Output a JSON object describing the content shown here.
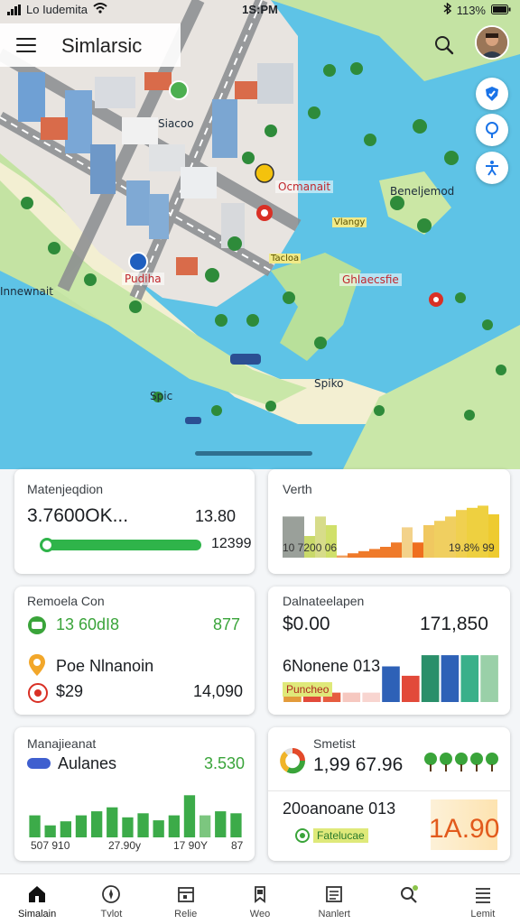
{
  "status_bar": {
    "carrier": "Lo Iudemita",
    "time": "1S:PM",
    "battery": "113%"
  },
  "app": {
    "title": "Simlarsic"
  },
  "map": {
    "labels": [
      "Siacoo",
      "Ocmanait",
      "Beneljemod",
      "Vlangy",
      "Tacloa",
      "Pudiha",
      "Ghlaecsfie",
      "Innewnait",
      "Spiko",
      "Spic"
    ]
  },
  "cards": {
    "card1": {
      "title": "Matenjeqdion",
      "value": "3.7600OK...",
      "right": "13.80",
      "progress_value": "12399",
      "progress_fraction": 0.97
    },
    "card2": {
      "title": "Verth",
      "chart_data": {
        "type": "bar",
        "values": [
          38,
          38,
          20,
          38,
          30,
          2,
          4,
          6,
          8,
          10,
          14,
          28,
          14,
          30,
          34,
          38,
          44,
          46,
          48,
          40
        ],
        "colors": [
          "#9aa09a",
          "#9aa09a",
          "#c9d96a",
          "#d7dc8a",
          "#d0e06a",
          "#f0a060",
          "#ef7a2a",
          "#ef7a2a",
          "#ef7a2a",
          "#ef7a2a",
          "#ef7a2a",
          "#f3d28a",
          "#ef6f1f",
          "#f0c860",
          "#f0cf60",
          "#f0cf60",
          "#f0d050",
          "#eed040",
          "#eed040",
          "#eecb30"
        ],
        "ylim": [
          0,
          50
        ]
      },
      "tick_left": "10 7200 06",
      "tick_right": "19.8% 99"
    },
    "card3": {
      "title": "Remoela Con",
      "row1_value": "13 60dI8",
      "row1_right": "877",
      "row2_label": "Poe Nlnanoin",
      "row3_value": "$29",
      "row3_right": "14,090"
    },
    "card4": {
      "title": "Dalnateelapen",
      "value_left": "$0.00",
      "value_right": "171,850",
      "sub_label": "6Nonene 013",
      "chart_label": "Puncheo",
      "chart_data": {
        "type": "bar",
        "values": [
          10,
          10,
          10,
          10,
          10,
          38,
          28,
          50,
          50,
          50,
          50
        ],
        "colors": [
          "#e39b3b",
          "#e24a3a",
          "#e65c3f",
          "#f6c8c0",
          "#f8d5d0",
          "#2e61b7",
          "#e24a3a",
          "#2a8f6a",
          "#2e61b7",
          "#3ab08a",
          "#9ad0a8"
        ],
        "ylim": [
          0,
          52
        ]
      }
    },
    "card5": {
      "title": "Manajieanat",
      "row_label": "Aulanes",
      "row_right": "3.530",
      "chart_data": {
        "type": "bar",
        "values": [
          22,
          12,
          16,
          22,
          26,
          30,
          20,
          24,
          17,
          22,
          42,
          22,
          26,
          24
        ],
        "colors": [
          "#3cab49",
          "#3cab49",
          "#3cab49",
          "#3cab49",
          "#3cab49",
          "#3cab49",
          "#3cab49",
          "#3cab49",
          "#3cab49",
          "#3cab49",
          "#3cab49",
          "#7cc67f",
          "#3cab49",
          "#3cab49"
        ],
        "ylim": [
          0,
          45
        ]
      },
      "ticks": [
        "507 910",
        "27.90y",
        "17 90Y",
        "87"
      ]
    },
    "card6": {
      "title": "Smetist",
      "value": "1,99 67.96",
      "sub_label": "20oanoane 013",
      "chip_label": "Fatelucae",
      "big_value": "1A.90"
    }
  },
  "bottom_nav": [
    {
      "label": "Simalain",
      "icon": "home-icon"
    },
    {
      "label": "Tvlot",
      "icon": "compass-icon"
    },
    {
      "label": "Relie",
      "icon": "calendar-icon"
    },
    {
      "label": "Weo",
      "icon": "bookmark-icon"
    },
    {
      "label": "Nanlert",
      "icon": "list-icon"
    },
    {
      "label": "",
      "icon": "search-icon"
    },
    {
      "label": "Lemit",
      "icon": "menu-icon"
    }
  ]
}
